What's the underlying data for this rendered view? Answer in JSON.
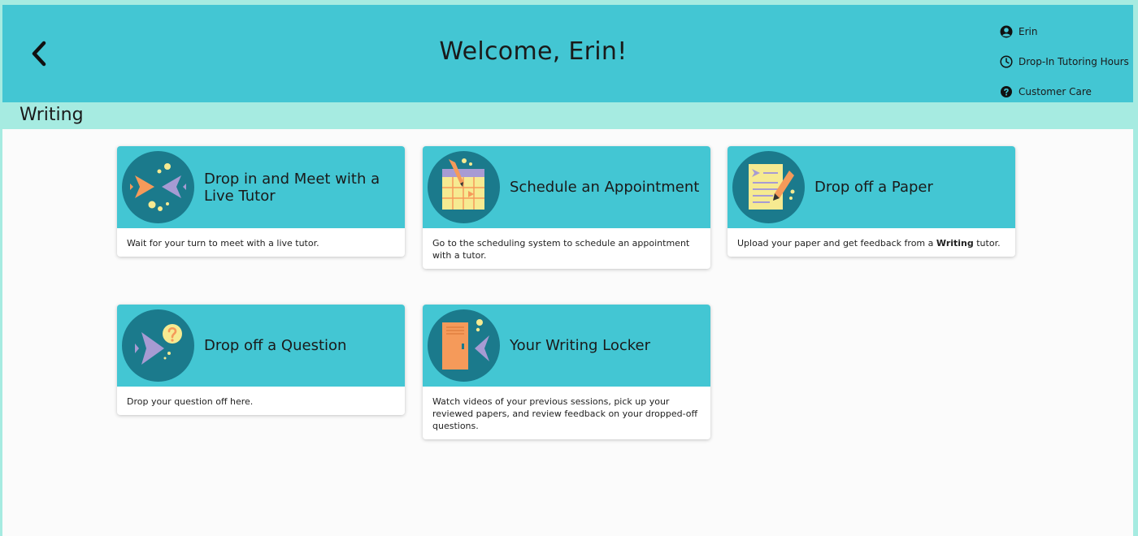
{
  "header": {
    "back_label": "Back",
    "title": "Welcome, Erin!",
    "user_menu": [
      {
        "label": "Erin",
        "icon": "user-circle-icon"
      },
      {
        "label": "Drop-In Tutoring Hours",
        "icon": "clock-icon"
      },
      {
        "label": "Customer Care",
        "icon": "question-circle-icon"
      }
    ]
  },
  "section": {
    "title": "Writing"
  },
  "cards": [
    {
      "title": "Drop in and Meet with a Live Tutor",
      "description": "Wait for your turn to meet with a live tutor.",
      "icon": "two-fish-icon"
    },
    {
      "title": "Schedule an Appointment",
      "description": "Go to the scheduling system to schedule an appointment with a tutor.",
      "icon": "calendar-icon"
    },
    {
      "title": "Drop off a Paper",
      "description_before": "Upload your paper and get feedback from a ",
      "description_bold": "Writing",
      "description_after": " tutor.",
      "icon": "paper-pencil-icon"
    },
    {
      "title": "Drop off a Question",
      "description": "Drop your question off here.",
      "icon": "fish-question-icon"
    },
    {
      "title": "Your Writing Locker",
      "description": "Watch videos of your previous sessions, pick up your reviewed papers, and review feedback on your dropped-off questions.",
      "icon": "locker-icon"
    }
  ],
  "colors": {
    "header_bg": "#43c6d3",
    "section_bg": "#a6ebe1",
    "icon_circle": "#1b7a8c",
    "orange": "#f59a5a",
    "purple": "#a79bd3",
    "yellow": "#f6ea91"
  }
}
